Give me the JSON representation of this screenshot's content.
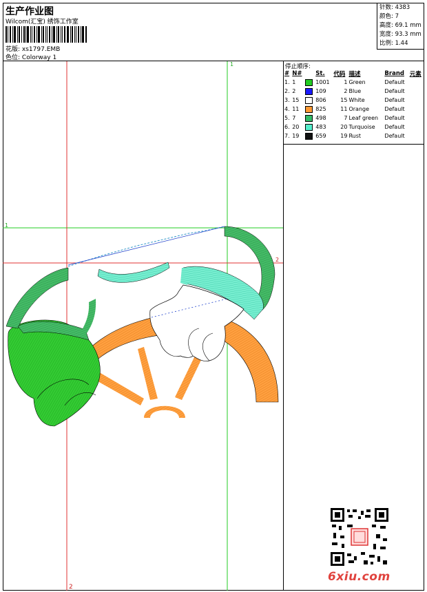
{
  "header": {
    "title": "生产作业图",
    "subtitle": "Wilcom(汇宝) 绣饰工作室",
    "design_label": "花版:",
    "design_value": "xs1797.EMB",
    "colorway_label": "色位:",
    "colorway_value": "Colorway 1"
  },
  "stats": {
    "stitches": "针数: 4383",
    "colors": "颜色: 7",
    "height": "高度: 69.1 mm",
    "width": "宽度: 93.3 mm",
    "scale": "比例: 1.44"
  },
  "canvas": {
    "guide_top_label": "1",
    "guide_left_label": "1",
    "guide_right_label": "2",
    "guide_bottom_label": "2"
  },
  "sequence": {
    "title": "停止顺序:",
    "columns": [
      "#",
      "N#",
      "St.",
      "代码",
      "描述",
      "Brand",
      "元素"
    ],
    "rows": [
      {
        "idx": "1.",
        "num": "1",
        "color": "#22cc22",
        "st": "1001",
        "code": "1",
        "desc": "Green",
        "brand": "Default"
      },
      {
        "idx": "2.",
        "num": "2",
        "color": "#1a1aff",
        "st": "109",
        "code": "2",
        "desc": "Blue",
        "brand": "Default"
      },
      {
        "idx": "3.",
        "num": "15",
        "color": "#ffffff",
        "st": "806",
        "code": "15",
        "desc": "White",
        "brand": "Default"
      },
      {
        "idx": "4.",
        "num": "11",
        "color": "#ff9933",
        "st": "825",
        "code": "11",
        "desc": "Orange",
        "brand": "Default"
      },
      {
        "idx": "5.",
        "num": "7",
        "color": "#33bb66",
        "st": "498",
        "code": "7",
        "desc": "Leaf green",
        "brand": "Default"
      },
      {
        "idx": "6.",
        "num": "20",
        "color": "#55eecc",
        "st": "483",
        "code": "20",
        "desc": "Turquoise",
        "brand": "Default"
      },
      {
        "idx": "7.",
        "num": "19",
        "color": "#111111",
        "st": "659",
        "code": "19",
        "desc": "Rust",
        "brand": "Default"
      }
    ]
  },
  "watermark": {
    "brand": "6xiu.com"
  },
  "colors": {
    "guide_green": "#22cc22",
    "guide_red": "#e03030",
    "green": "#33cc33",
    "leaf_green": "#33bb66",
    "turquoise": "#66eecc",
    "orange": "#ff9933",
    "blue": "#2244cc"
  }
}
